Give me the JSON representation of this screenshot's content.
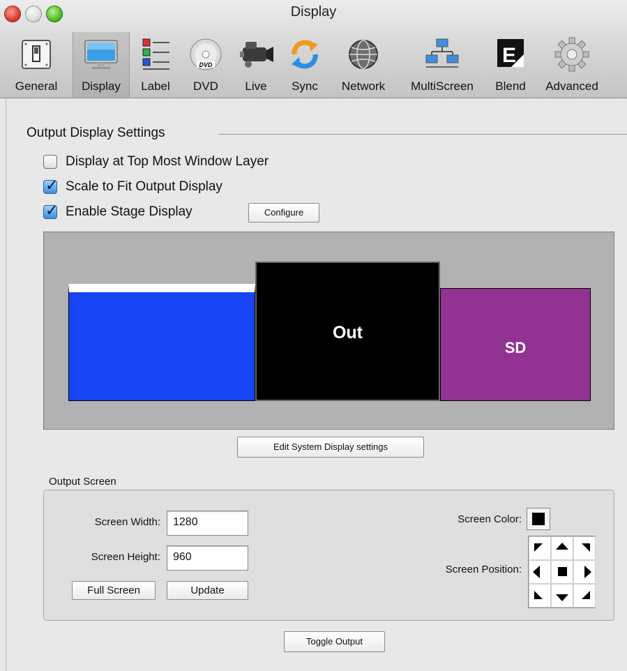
{
  "window": {
    "title": "Display"
  },
  "toolbar": {
    "items": [
      {
        "label": "General",
        "icon": "switch-icon"
      },
      {
        "label": "Display",
        "icon": "monitor-icon",
        "selected": true
      },
      {
        "label": "Label",
        "icon": "color-list-icon"
      },
      {
        "label": "DVD",
        "icon": "dvd-disc-icon"
      },
      {
        "label": "Live",
        "icon": "video-camera-icon"
      },
      {
        "label": "Sync",
        "icon": "sync-arrows-icon"
      },
      {
        "label": "Network",
        "icon": "globe-icon"
      },
      {
        "label": "MultiScreen",
        "icon": "network-screens-icon"
      },
      {
        "label": "Blend",
        "icon": "blend-e-icon"
      },
      {
        "label": "Advanced",
        "icon": "gear-icon"
      }
    ]
  },
  "output_display": {
    "title": "Output Display Settings",
    "top_most": {
      "label": "Display at Top Most Window Layer",
      "checked": false
    },
    "scale_to_fit": {
      "label": "Scale to Fit Output Display",
      "checked": true
    },
    "stage_display": {
      "label": "Enable Stage Display",
      "checked": true
    },
    "configure_label": "Configure",
    "preview": {
      "screens": [
        {
          "label": "",
          "color": "#1744f5"
        },
        {
          "label": "Out",
          "color": "#000000"
        },
        {
          "label": "SD",
          "color": "#923293"
        }
      ]
    },
    "edit_system_label": "Edit System Display settings"
  },
  "output_screen": {
    "title": "Output Screen",
    "width_label": "Screen Width:",
    "width_value": "1280",
    "height_label": "Screen Height:",
    "height_value": "960",
    "full_screen_label": "Full Screen",
    "update_label": "Update",
    "color_label": "Screen Color:",
    "color_value": "#000000",
    "position_label": "Screen Position:",
    "selected_position": "center"
  },
  "toggle_output_label": "Toggle Output"
}
